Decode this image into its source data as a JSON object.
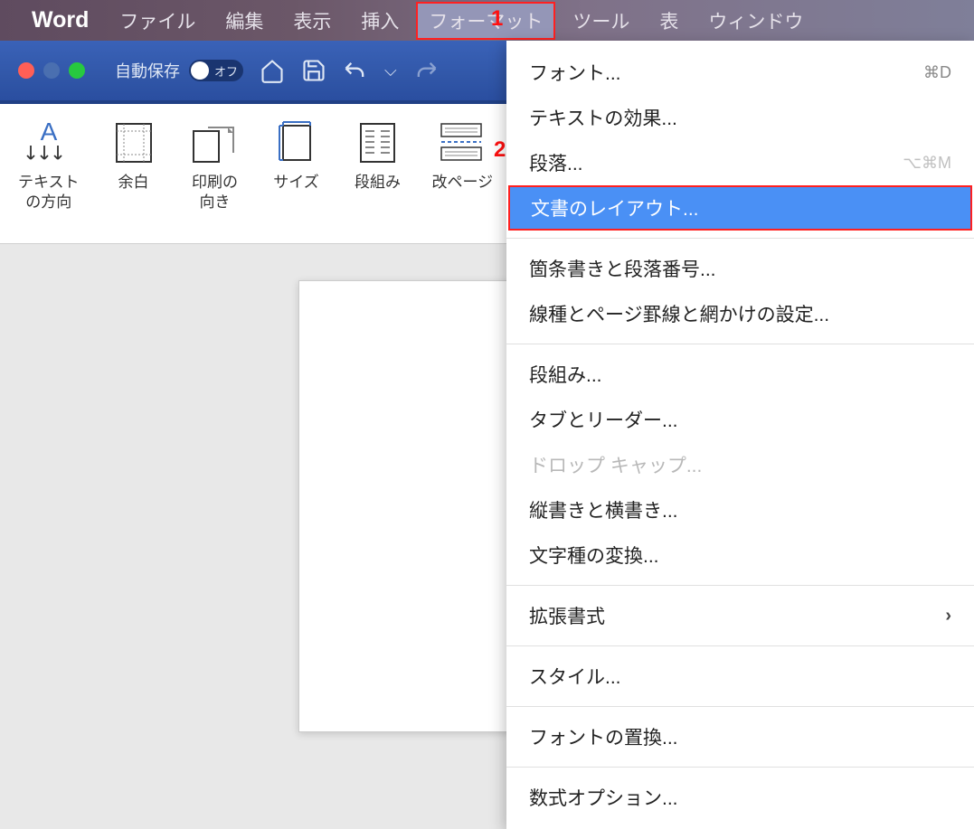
{
  "menubar": {
    "app_name": "Word",
    "items": [
      "ファイル",
      "編集",
      "表示",
      "挿入",
      "フォーマット",
      "ツール",
      "表",
      "ウィンドウ"
    ],
    "highlighted_index": 4
  },
  "annotations": {
    "num1": "1",
    "num2": "2"
  },
  "toolbar": {
    "autosave_label": "自動保存",
    "autosave_state": "オフ"
  },
  "ribbon": {
    "items": [
      {
        "label": "テキスト\nの方向",
        "icon": "text-direction"
      },
      {
        "label": "余白",
        "icon": "margins"
      },
      {
        "label": "印刷の\n向き",
        "icon": "orientation"
      },
      {
        "label": "サイズ",
        "icon": "size"
      },
      {
        "label": "段組み",
        "icon": "columns"
      },
      {
        "label": "改ページ",
        "icon": "breaks"
      }
    ]
  },
  "dropdown": {
    "items": [
      {
        "label": "フォント...",
        "shortcut": "⌘D",
        "type": "item"
      },
      {
        "label": "テキストの効果...",
        "type": "item"
      },
      {
        "label": "段落...",
        "shortcut": "⌥⌘M",
        "type": "item",
        "shortcut_disabled": true
      },
      {
        "label": "文書のレイアウト...",
        "type": "item",
        "highlighted": true
      },
      {
        "type": "separator"
      },
      {
        "label": "箇条書きと段落番号...",
        "type": "item"
      },
      {
        "label": "線種とページ罫線と網かけの設定...",
        "type": "item"
      },
      {
        "type": "separator"
      },
      {
        "label": "段組み...",
        "type": "item"
      },
      {
        "label": "タブとリーダー...",
        "type": "item"
      },
      {
        "label": "ドロップ キャップ...",
        "type": "item",
        "disabled": true
      },
      {
        "label": "縦書きと横書き...",
        "type": "item"
      },
      {
        "label": "文字種の変換...",
        "type": "item"
      },
      {
        "type": "separator"
      },
      {
        "label": "拡張書式",
        "type": "submenu"
      },
      {
        "type": "separator"
      },
      {
        "label": "スタイル...",
        "type": "item"
      },
      {
        "type": "separator"
      },
      {
        "label": "フォントの置換...",
        "type": "item"
      },
      {
        "type": "separator"
      },
      {
        "label": "数式オプション...",
        "type": "item"
      }
    ]
  }
}
